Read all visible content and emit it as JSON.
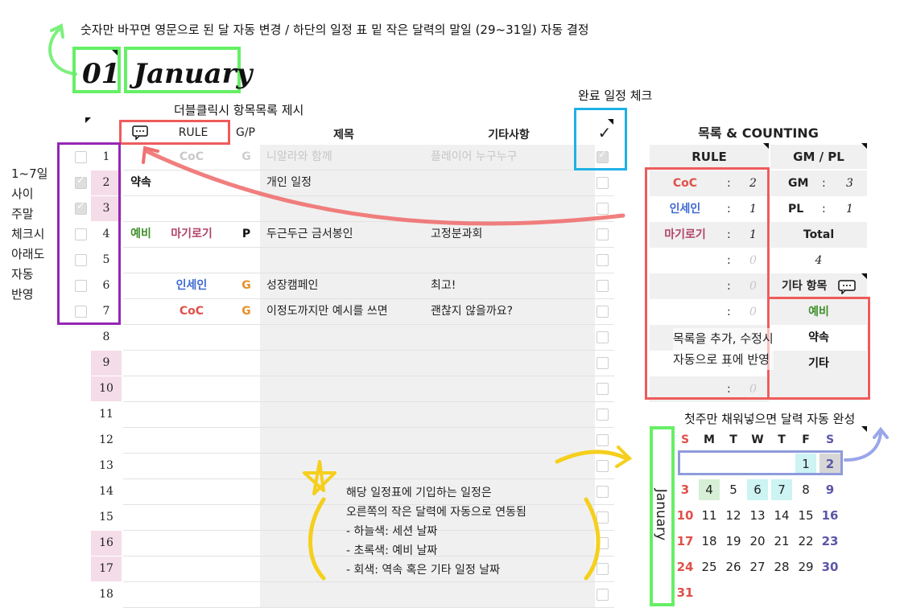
{
  "notes": {
    "top": "숫자만 바꾸면 영문으로 된 달 자동 변경 / 하단의 일정 표 밑 작은 달력의 말일 (29~31일) 자동 결정",
    "dblclick": "더블클릭시 항목목록 제시",
    "done_check": "완료 일정 체크",
    "weekend_lines": [
      "1~7일",
      "사이",
      "주말",
      "체크시",
      "아래도",
      "자동",
      "반영"
    ],
    "list_edit_lines": [
      "목록을 추가, 수정시",
      "자동으로 표에 반영"
    ],
    "first_week": "첫주만 채워넣으면 달력 자동 완성",
    "calendar_link_lines": [
      "해당 일정표에 기입하는 일정은",
      "오른쪽의 작은 달력에 자동으로 연동됨",
      "- 하늘색: 세션 날짜",
      "- 초록색: 예비 날짜",
      "- 회색: 역속 혹은 기타 일정 날짜"
    ]
  },
  "month": {
    "number": "01",
    "name": "January"
  },
  "table": {
    "headers": {
      "rule": "RULE",
      "gp": "G/P",
      "title": "제목",
      "etc": "기타사항",
      "check": "✓"
    },
    "rows": [
      {
        "day": "1",
        "pink": false,
        "weekend_checked": false,
        "tag": "",
        "rule": "CoC",
        "rule_color": "#c9c9c9",
        "gp": "G",
        "gp_color": "#cfcfcf",
        "title": "니알라와 함께",
        "etc": "플레이어 누구누구",
        "done": true,
        "faded": true
      },
      {
        "day": "2",
        "pink": true,
        "weekend_checked": true,
        "tag": "약속",
        "rule": "",
        "gp": "",
        "title": "개인 일정",
        "etc": "",
        "done": false
      },
      {
        "day": "3",
        "pink": true,
        "weekend_checked": true,
        "tag": "",
        "rule": "",
        "gp": "",
        "title": "",
        "etc": "",
        "done": false
      },
      {
        "day": "4",
        "pink": false,
        "weekend_checked": false,
        "tag": "예비",
        "rule": "마기로기",
        "rule_color": "#b2436a",
        "gp": "P",
        "gp_color": "#111111",
        "title": "두근두근 금서봉인",
        "etc": "고정분과회",
        "done": false
      },
      {
        "day": "5",
        "pink": false,
        "weekend_checked": false,
        "tag": "",
        "rule": "",
        "gp": "",
        "title": "",
        "etc": "",
        "done": false
      },
      {
        "day": "6",
        "pink": false,
        "weekend_checked": false,
        "tag": "",
        "rule": "인세인",
        "rule_color": "#3f6ad1",
        "gp": "G",
        "gp_color": "#e8902a",
        "title": "성장캠페인",
        "etc": "최고!",
        "done": false
      },
      {
        "day": "7",
        "pink": false,
        "weekend_checked": false,
        "tag": "",
        "rule": "CoC",
        "rule_color": "#e0504a",
        "gp": "G",
        "gp_color": "#e8902a",
        "title": "이정도까지만 예시를 쓰면",
        "etc": "괜찮지 않을까요?",
        "done": false
      },
      {
        "day": "8",
        "pink": false
      },
      {
        "day": "9",
        "pink": true
      },
      {
        "day": "10",
        "pink": true
      },
      {
        "day": "11",
        "pink": false
      },
      {
        "day": "12",
        "pink": false
      },
      {
        "day": "13",
        "pink": false
      },
      {
        "day": "14",
        "pink": false
      },
      {
        "day": "15",
        "pink": false
      },
      {
        "day": "16",
        "pink": true
      },
      {
        "day": "17",
        "pink": true
      },
      {
        "day": "18",
        "pink": false
      }
    ]
  },
  "side": {
    "title": "목록 & COUNTING",
    "rule_header": "RULE",
    "gmpl_header": "GM / PL",
    "rules": [
      {
        "name": "CoC",
        "color": "#e0504a",
        "count": "2"
      },
      {
        "name": "인세인",
        "color": "#3f6ad1",
        "count": "1"
      },
      {
        "name": "마기로기",
        "color": "#b2436a",
        "count": "1"
      },
      {
        "name": "",
        "count": "0"
      },
      {
        "name": "",
        "count": "0"
      },
      {
        "name": "",
        "count": "0"
      },
      {
        "name": "",
        "count": "0"
      },
      {
        "name": "",
        "count": "0"
      },
      {
        "name": "",
        "count": "0"
      }
    ],
    "gm_label": "GM",
    "gm_count": "3",
    "pl_label": "PL",
    "pl_count": "1",
    "total_label": "Total",
    "total_value": "4",
    "etc_header": "기타 항목",
    "etc_items": [
      {
        "name": "예비",
        "color": "#3f8f2a"
      },
      {
        "name": "약속",
        "color": "#111111"
      },
      {
        "name": "기타",
        "color": "#111111"
      }
    ]
  },
  "calendar": {
    "month_label": "January",
    "weekdays": [
      "S",
      "M",
      "T",
      "W",
      "T",
      "F",
      "S"
    ],
    "weeks": [
      [
        "",
        "",
        "",
        "",
        "",
        "1",
        "2"
      ],
      [
        "3",
        "4",
        "5",
        "6",
        "7",
        "8",
        "9"
      ],
      [
        "10",
        "11",
        "12",
        "13",
        "14",
        "15",
        "16"
      ],
      [
        "17",
        "18",
        "19",
        "20",
        "21",
        "22",
        "23"
      ],
      [
        "24",
        "25",
        "26",
        "27",
        "28",
        "29",
        "30"
      ],
      [
        "31",
        "",
        "",
        "",
        "",
        "",
        ""
      ]
    ],
    "highlights": {
      "1": "#cdf3f3",
      "2": "#d6d6d6",
      "4": "#d6efd6",
      "6": "#cdf3f3",
      "7": "#cdf3f3"
    },
    "sunday_color": "#e0504a",
    "saturday_color": "#5c56a8"
  }
}
